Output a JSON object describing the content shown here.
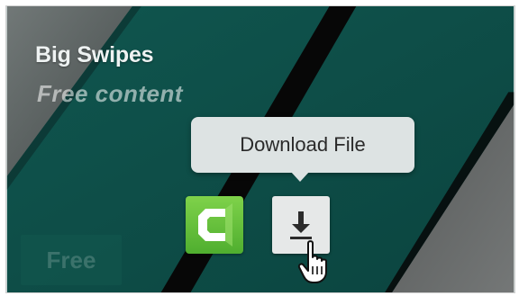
{
  "card": {
    "title": "Big Swipes",
    "subtitle": "Free content",
    "badge": "Free"
  },
  "tooltip": {
    "text": "Download File"
  },
  "actions": {
    "camtasia": {
      "icon": "camtasia-icon"
    },
    "download": {
      "icon": "download-icon"
    }
  },
  "colors": {
    "teal_bg": "#0e4f49",
    "stripe": "#0a0a0a",
    "gray_corner": "#6a6a6a",
    "tooltip_bg": "#dde3e3",
    "camtasia_green": "#5cc036"
  }
}
